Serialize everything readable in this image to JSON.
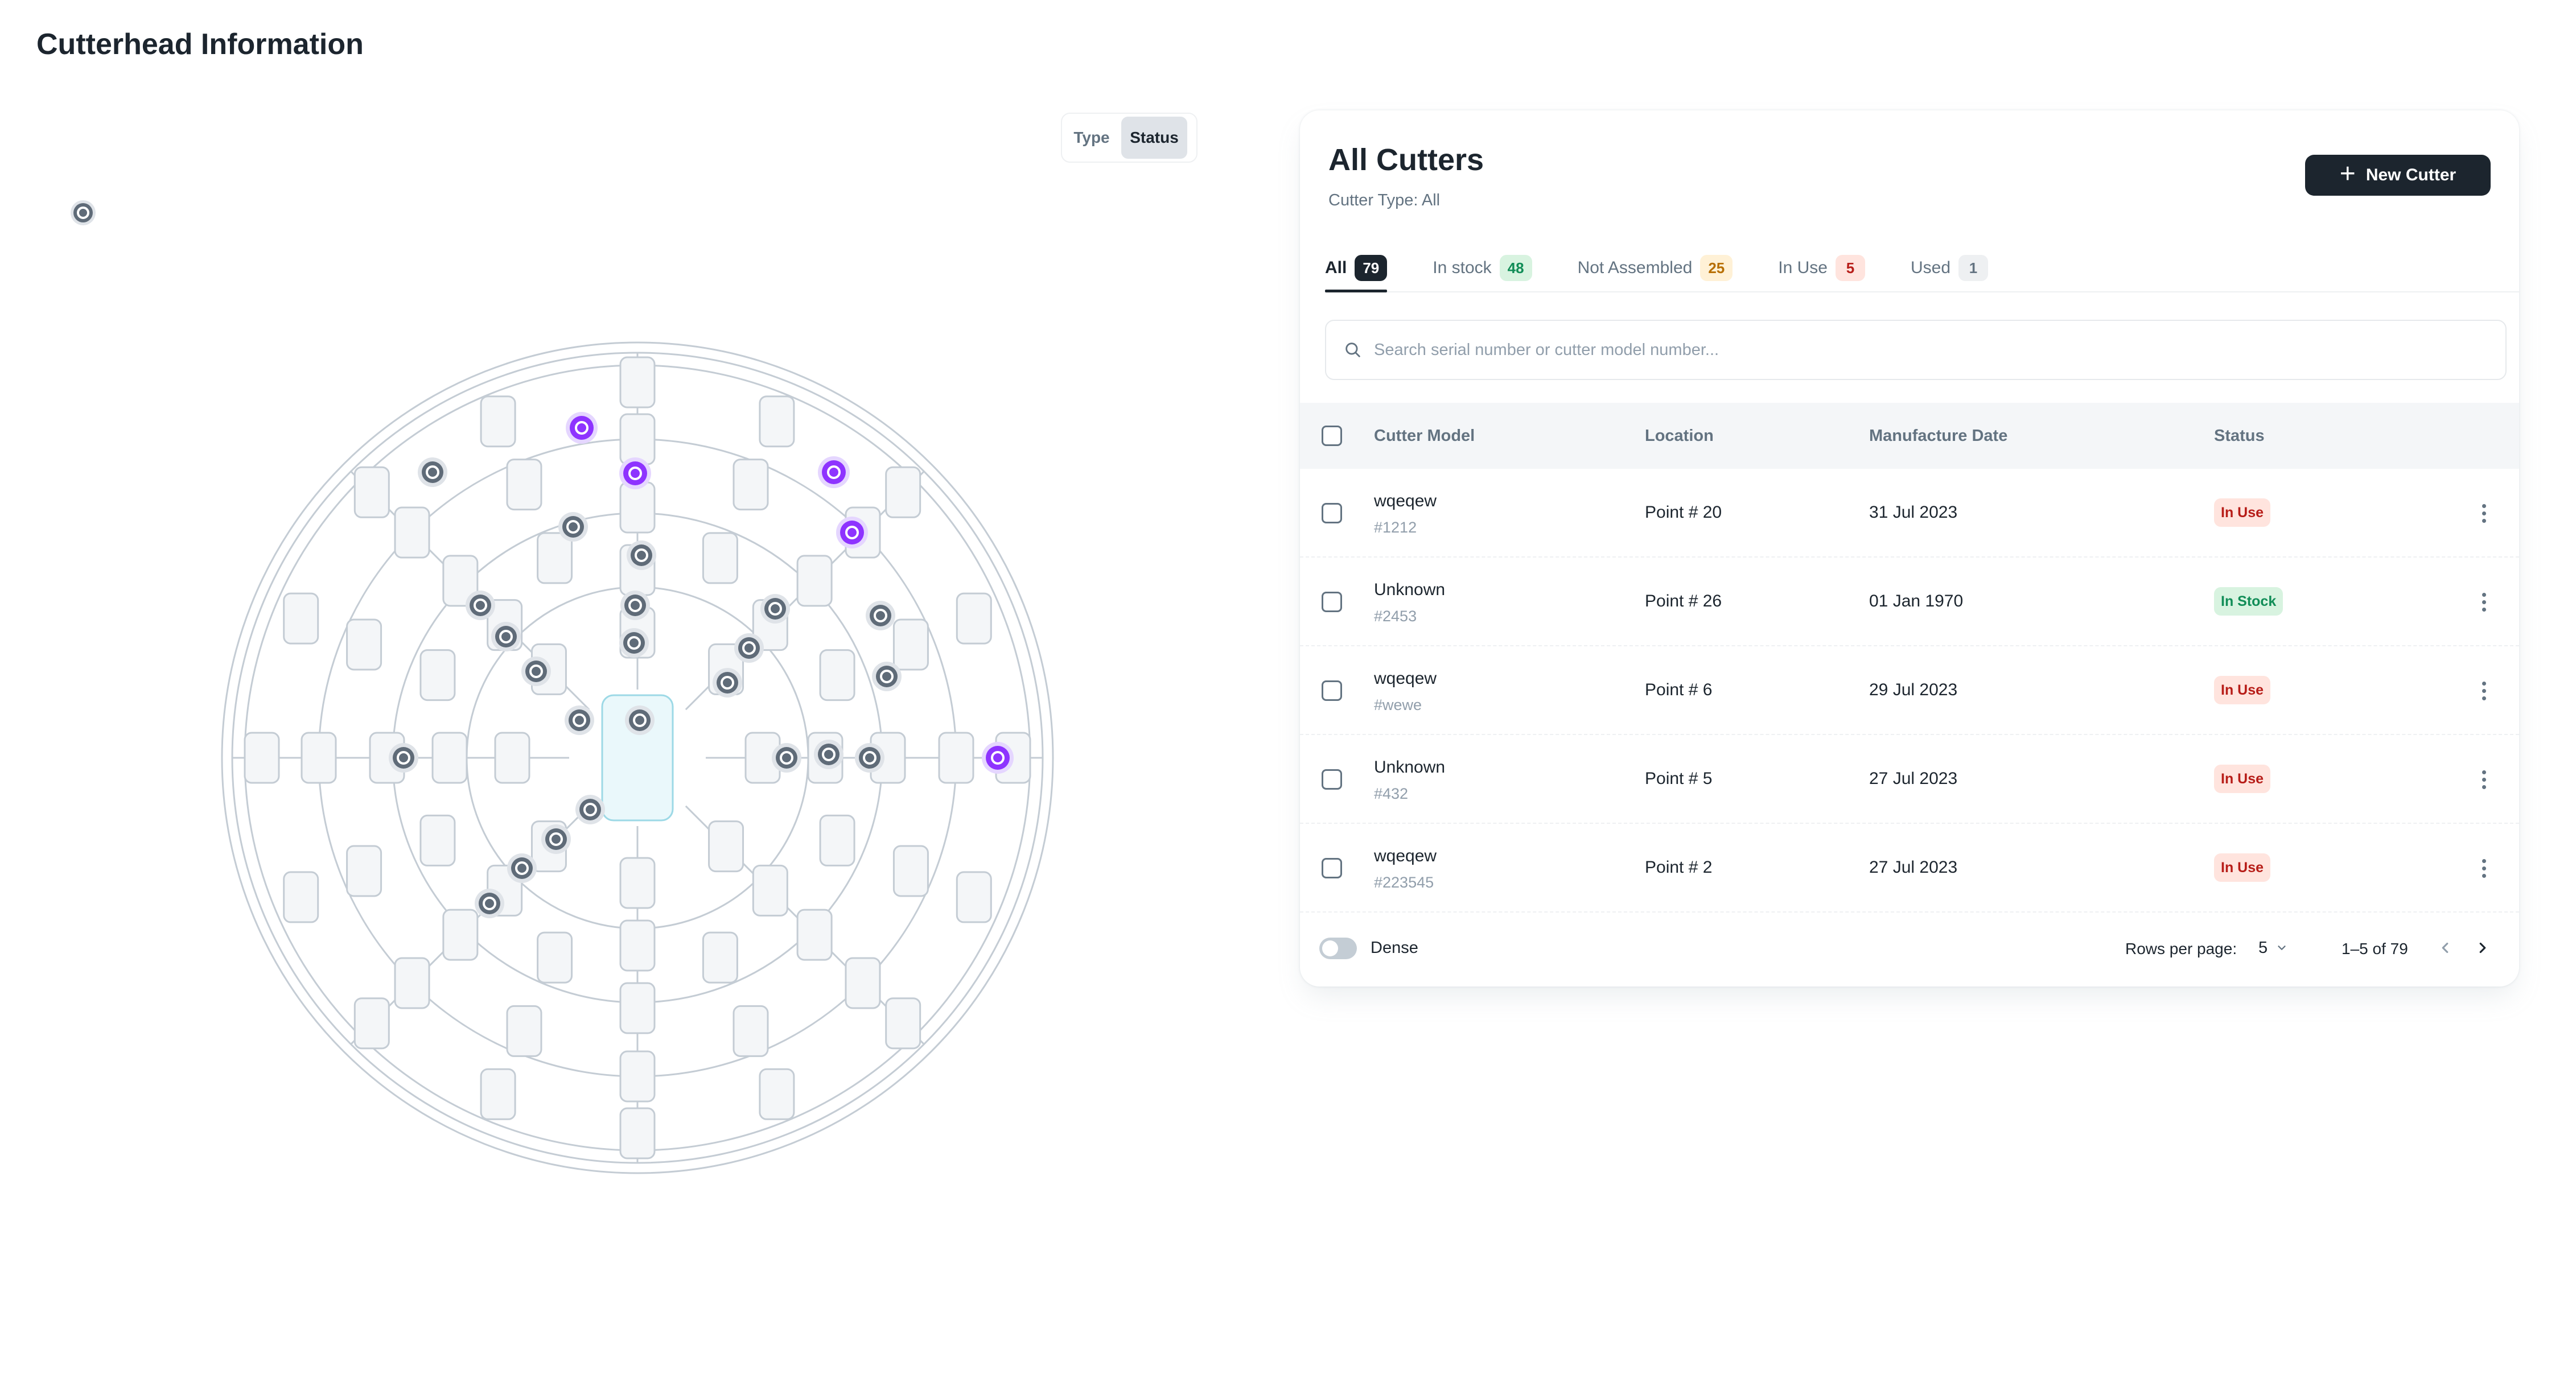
{
  "page": {
    "title": "Cutterhead Information"
  },
  "view_toggle": {
    "type_label": "Type",
    "status_label": "Status",
    "selected": "Status"
  },
  "colors": {
    "primary": "#1c252e",
    "in_use": "#b71d18",
    "in_stock": "#118d57",
    "marker_default": "#5f6b78",
    "marker_highlight": "#8e33ff"
  },
  "card": {
    "title": "All Cutters",
    "subtitle": "Cutter Type: All",
    "new_button_label": "New Cutter",
    "tabs": [
      {
        "label": "All",
        "count": "79"
      },
      {
        "label": "In stock",
        "count": "48"
      },
      {
        "label": "Not Assembled",
        "count": "25"
      },
      {
        "label": "In Use",
        "count": "5"
      },
      {
        "label": "Used",
        "count": "1"
      }
    ],
    "search": {
      "placeholder": "Search serial number or cutter model number..."
    },
    "columns": {
      "model": "Cutter Model",
      "location": "Location",
      "date": "Manufacture Date",
      "status": "Status"
    },
    "rows": [
      {
        "model": "wqeqew",
        "serial": "#1212",
        "location": "Point # 20",
        "date": "31 Jul 2023",
        "status": "In Use"
      },
      {
        "model": "Unknown",
        "serial": "#2453",
        "location": "Point # 26",
        "date": "01 Jan 1970",
        "status": "In Stock"
      },
      {
        "model": "wqeqew",
        "serial": "#wewe",
        "location": "Point # 6",
        "date": "29 Jul 2023",
        "status": "In Use"
      },
      {
        "model": "Unknown",
        "serial": "#432",
        "location": "Point # 5",
        "date": "27 Jul 2023",
        "status": "In Use"
      },
      {
        "model": "wqeqew",
        "serial": "#223545",
        "location": "Point # 2",
        "date": "27 Jul 2023",
        "status": "In Use"
      }
    ],
    "footer": {
      "dense_label": "Dense",
      "rows_per_page_label": "Rows per page:",
      "rows_per_page": "5",
      "range": "1–5 of 79"
    }
  }
}
